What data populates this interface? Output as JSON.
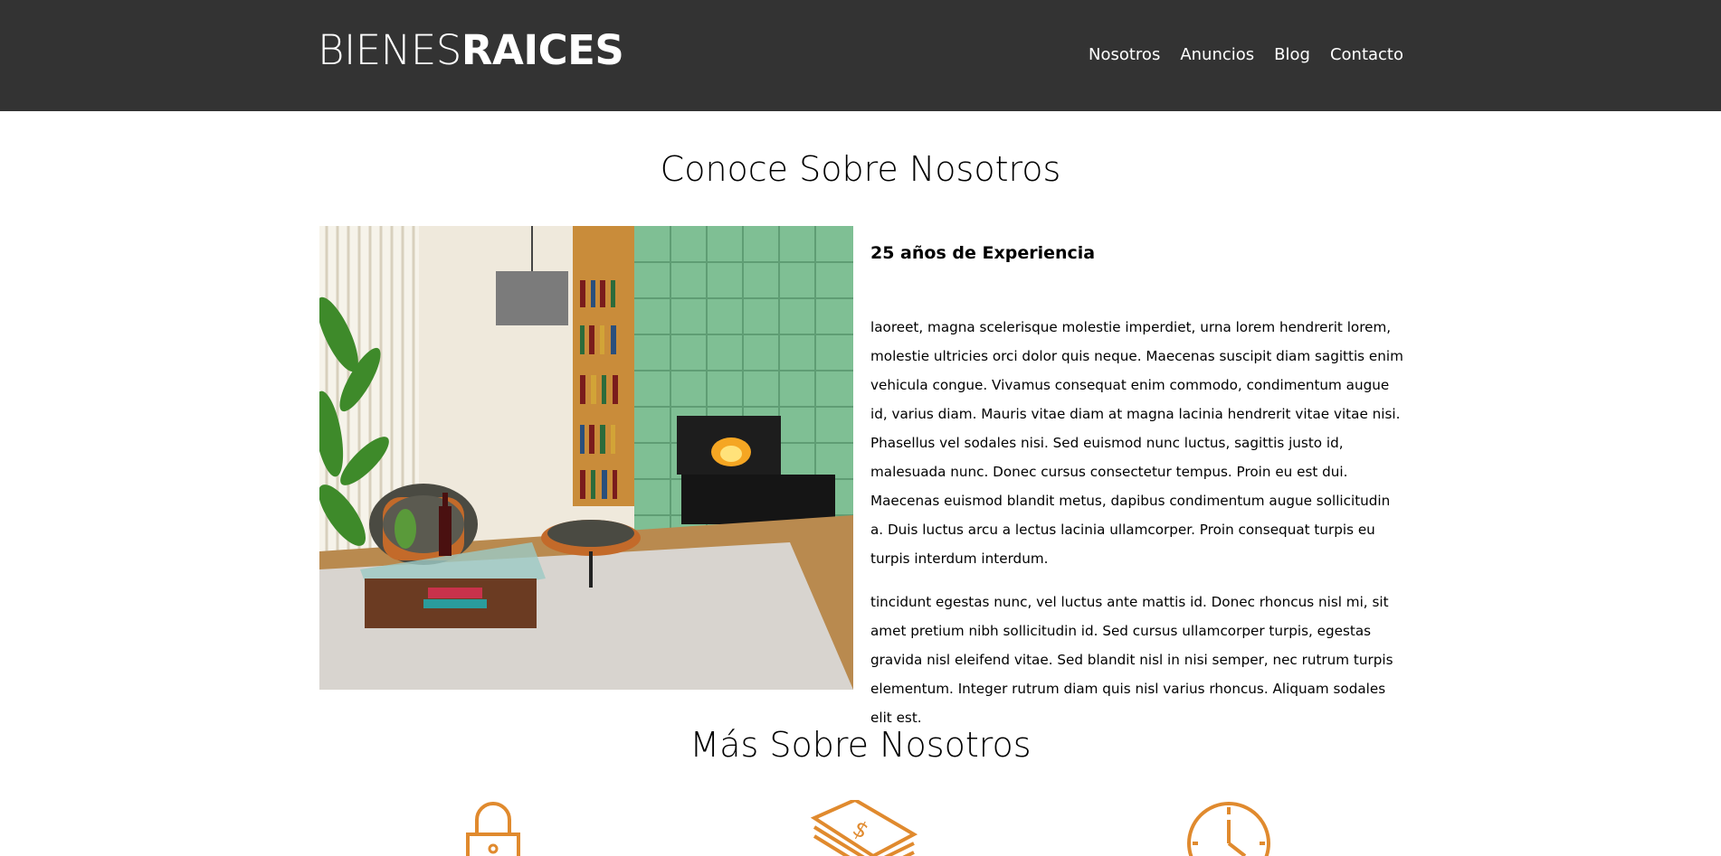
{
  "header": {
    "logo_light": "BIENES",
    "logo_bold": "RAICES",
    "nav": [
      "Nosotros",
      "Anuncios",
      "Blog",
      "Contacto"
    ],
    "background": "#333333"
  },
  "about": {
    "title": "Conoce Sobre Nosotros",
    "image_alt": "living-room-photo",
    "subtitle": "25 años de Experiencia",
    "paragraph_1": "laoreet, magna scelerisque molestie imperdiet, urna lorem hendrerit lorem, molestie ultricies orci dolor quis neque. Maecenas suscipit diam sagittis enim vehicula congue. Vivamus consequat enim commodo, condimentum augue id, varius diam. Mauris vitae diam at magna lacinia hendrerit vitae vitae nisi. Phasellus vel sodales nisi. Sed euismod nunc luctus, sagittis justo id, malesuada nunc. Donec cursus consectetur tempus. Proin eu est dui. Maecenas euismod blandit metus, dapibus condimentum augue sollicitudin a. Duis luctus arcu a lectus lacinia ullamcorper. Proin consequat turpis eu turpis interdum interdum.",
    "paragraph_2": "tincidunt egestas nunc, vel luctus ante mattis id. Donec rhoncus nisl mi, sit amet pretium nibh sollicitudin id. Sed cursus ullamcorper turpis, egestas gravida nisl eleifend vitae. Sed blandit nisl in nisi semper, nec rutrum turpis elementum. Integer rutrum diam quis nisl varius rhoncus. Aliquam sodales elit est."
  },
  "more": {
    "title": "Más Sobre Nosotros",
    "icons": [
      "lock-icon",
      "money-icon",
      "clock-icon"
    ],
    "accent": "#e08a2e"
  }
}
